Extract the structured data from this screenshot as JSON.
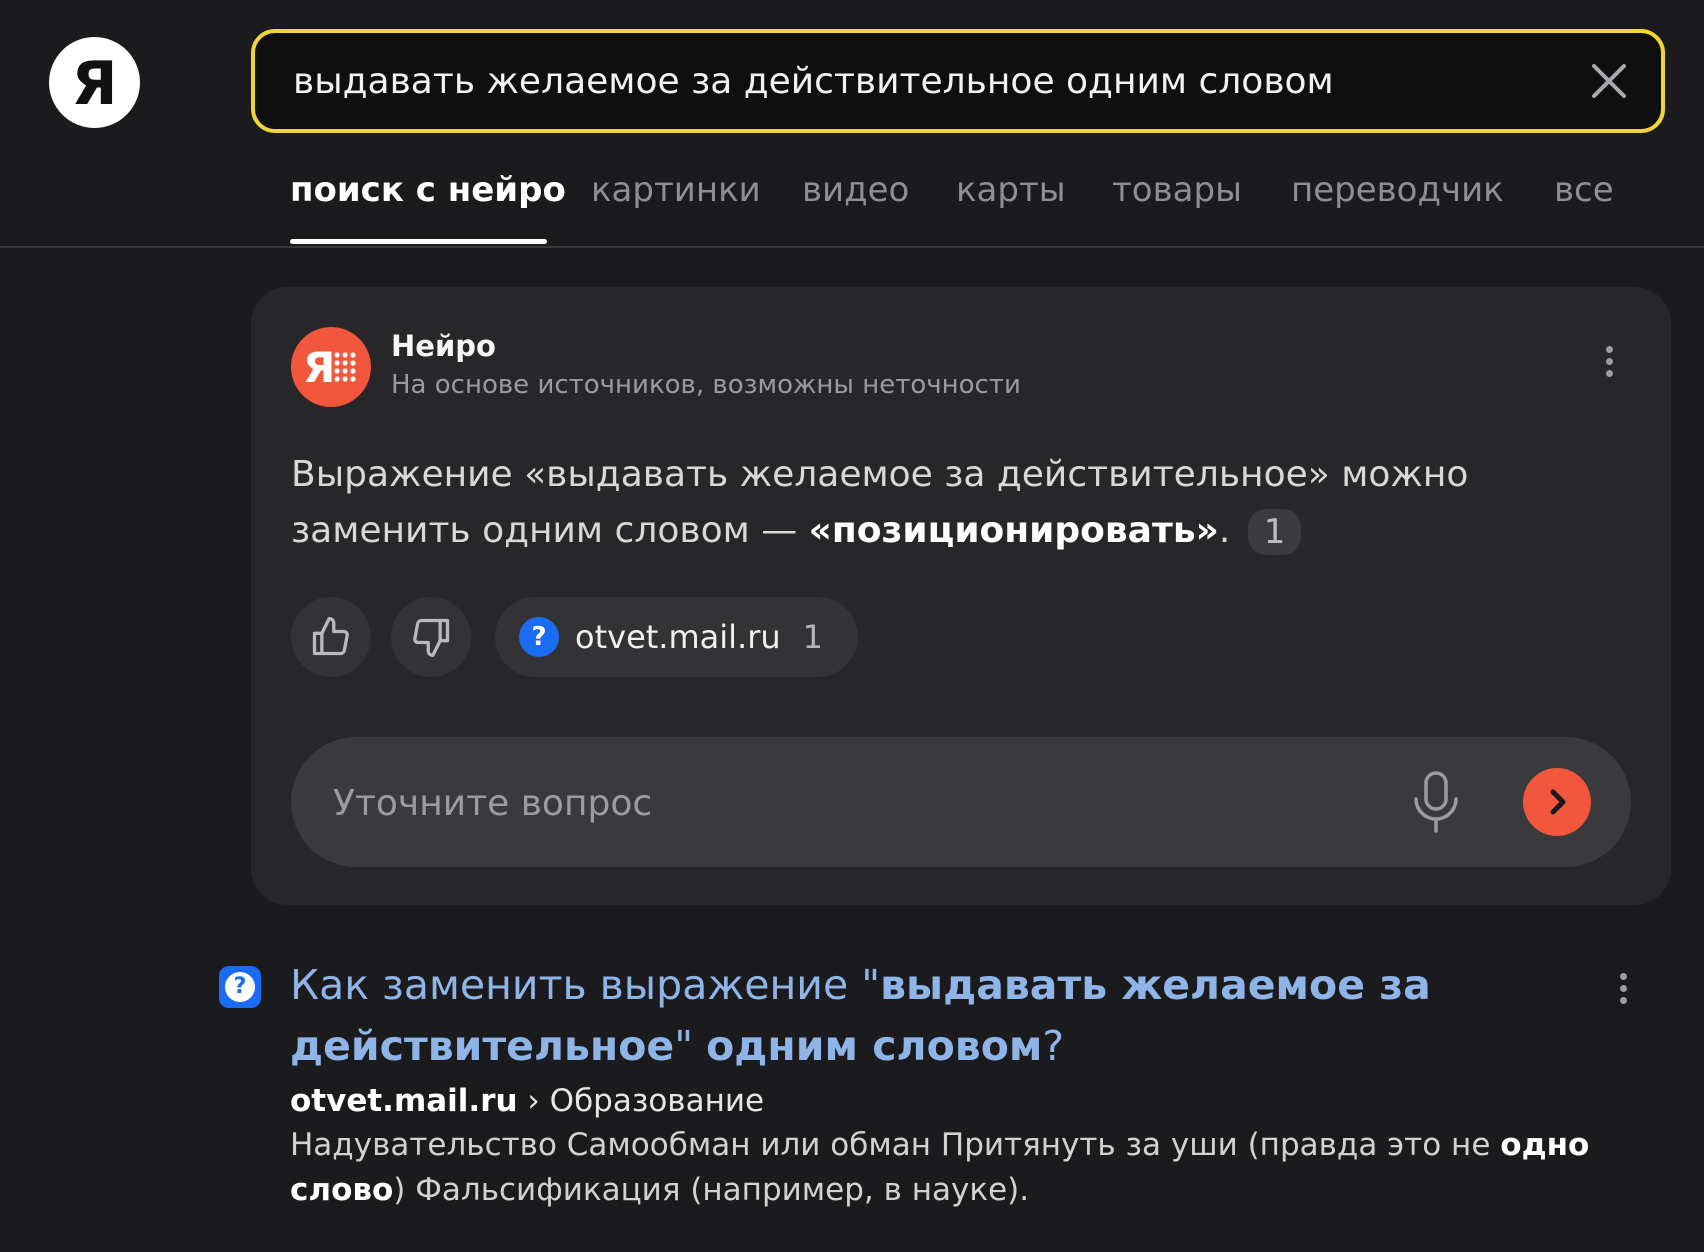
{
  "logo": {
    "letter": "Я"
  },
  "search": {
    "query": "выдавать желаемое за действительное одним словом"
  },
  "tabs": [
    {
      "label": "поиск с нейро",
      "active": true
    },
    {
      "label": "картинки"
    },
    {
      "label": "видео"
    },
    {
      "label": "карты"
    },
    {
      "label": "товары"
    },
    {
      "label": "переводчик"
    },
    {
      "label": "все"
    }
  ],
  "neuro": {
    "name": "Нейро",
    "subtitle": "На основе источников, возможны неточности",
    "answer_before": "Выражение «выдавать желаемое за действительное» можно заменить одним словом — ",
    "answer_bold": "«позиционировать»",
    "answer_after": ".",
    "answer_ref": "1",
    "source": {
      "site": "otvet.mail.ru",
      "count": "1"
    },
    "followup_placeholder": "Уточните вопрос"
  },
  "result": {
    "title_parts": [
      {
        "text": "Как заменить выражение \"",
        "bold": false
      },
      {
        "text": "выдавать желаемое за действи­тельное",
        "bold": true
      },
      {
        "text": "\" ",
        "bold": false
      },
      {
        "text": "одним словом",
        "bold": true
      },
      {
        "text": "?",
        "bold": false
      }
    ],
    "url_site": "otvet.mail.ru",
    "url_path": " › Образование",
    "snippet_parts": [
      {
        "text": "Надувательство Самообман или обман Притянуть за уши (правда это не ",
        "bold": false
      },
      {
        "text": "одно слово",
        "bold": true
      },
      {
        "text": ") Фальсификация (например, в науке).",
        "bold": false
      }
    ]
  },
  "colors": {
    "accent_yellow": "#f2d338",
    "neuro_orange": "#f2563c",
    "link_blue": "#8fb4e8",
    "mail_blue": "#1a6cf2"
  }
}
